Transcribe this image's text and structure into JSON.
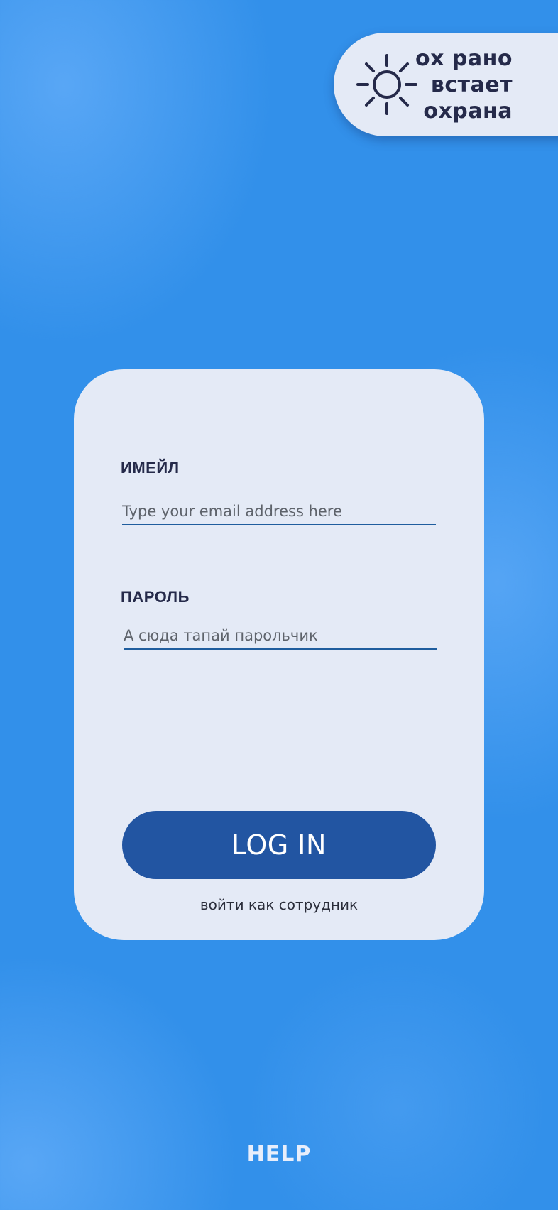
{
  "brand": {
    "icon": "sun-icon",
    "lines": [
      "ох рано",
      "встает",
      "охрана"
    ]
  },
  "login": {
    "email_label": "ИМЕЙЛ",
    "email_placeholder": "Type your email address here",
    "email_value": "",
    "password_label": "ПАРОЛЬ",
    "password_placeholder": "А сюда тапай парольчик",
    "password_value": "",
    "login_button": "LOG IN",
    "employee_link": "войти как сотрудник"
  },
  "help": {
    "label": "HELP"
  },
  "colors": {
    "background": "#3290ea",
    "card": "#e4eaf6",
    "button": "#2255a2",
    "text_dark": "#252a4a",
    "input_underline": "#1f5d9e"
  }
}
